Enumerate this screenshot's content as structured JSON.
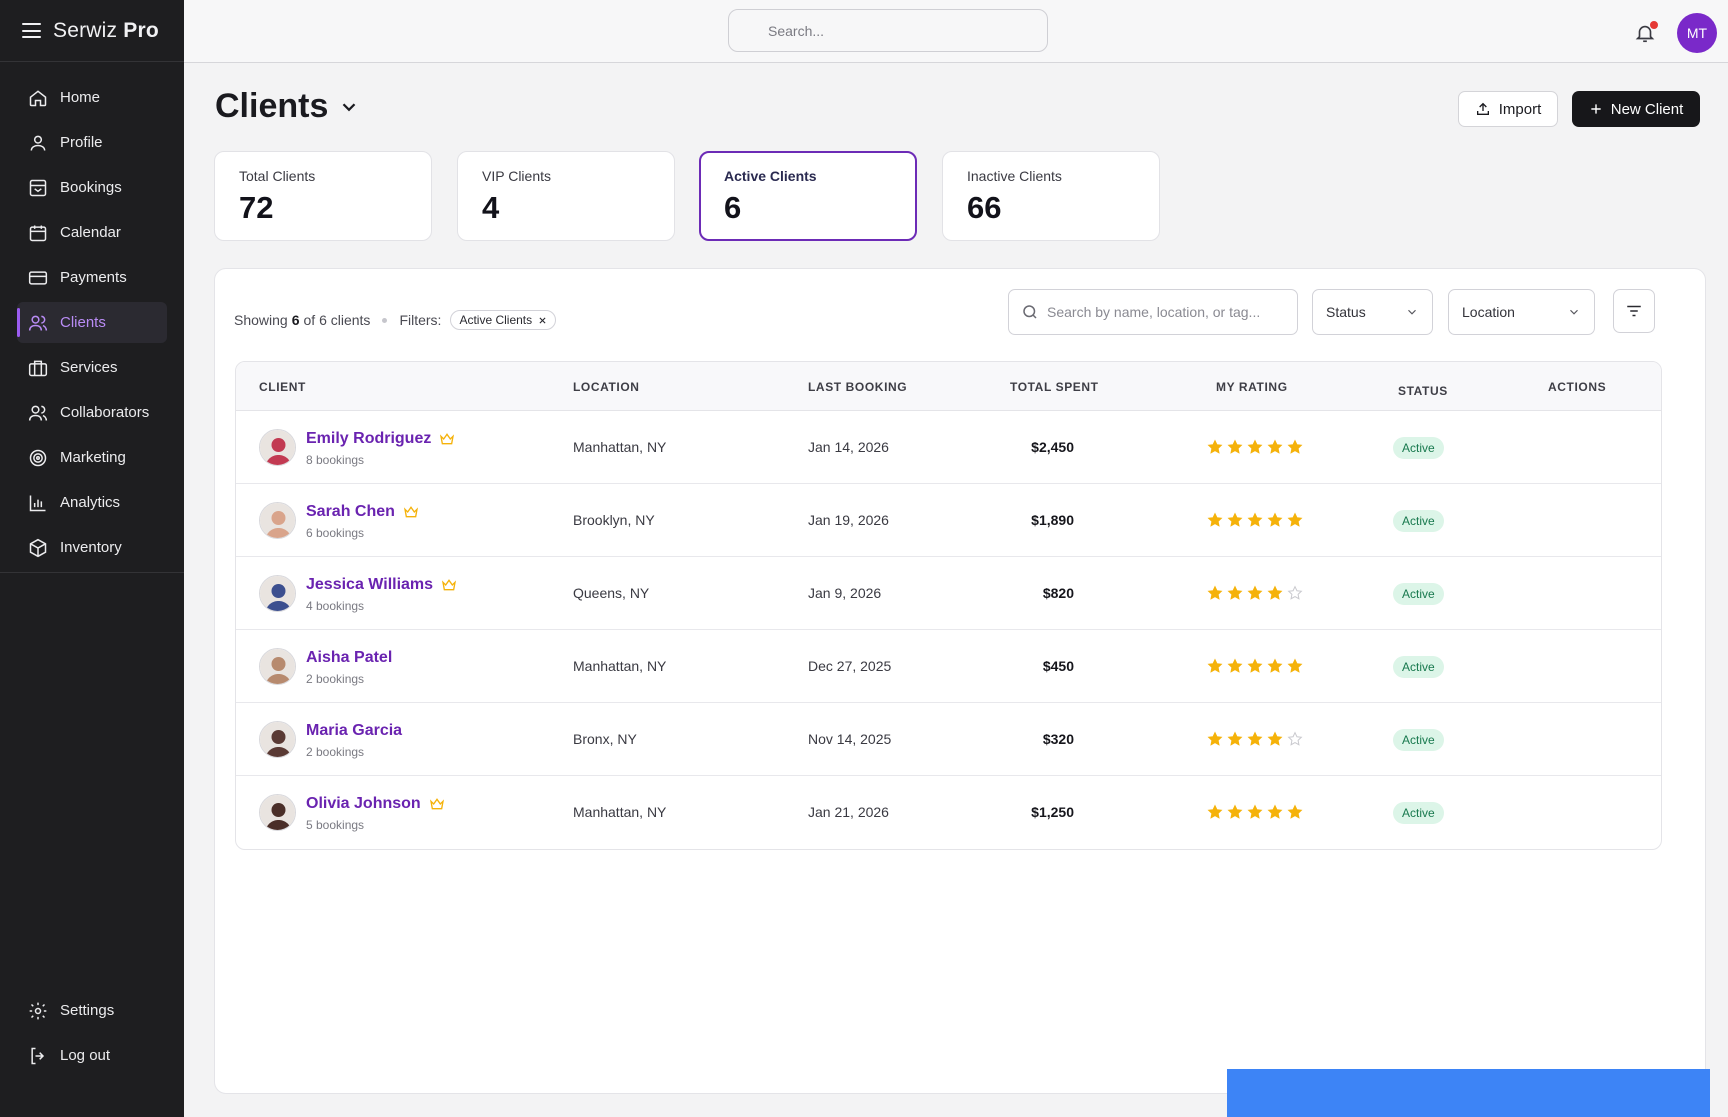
{
  "brand": {
    "name": "Serwiz",
    "suffix": "Pro"
  },
  "nav": {
    "items": [
      {
        "label": "Home",
        "icon": "home-icon"
      },
      {
        "label": "Profile",
        "icon": "user-icon"
      },
      {
        "label": "Bookings",
        "icon": "inbox-icon"
      },
      {
        "label": "Calendar",
        "icon": "calendar-icon"
      },
      {
        "label": "Payments",
        "icon": "card-icon"
      },
      {
        "label": "Clients",
        "icon": "users-icon",
        "active": true
      },
      {
        "label": "Services",
        "icon": "briefcase-icon"
      },
      {
        "label": "Collaborators",
        "icon": "users-icon"
      },
      {
        "label": "Marketing",
        "icon": "target-icon"
      },
      {
        "label": "Analytics",
        "icon": "bar-chart-icon"
      },
      {
        "label": "Inventory",
        "icon": "box-icon"
      }
    ],
    "bottom": [
      {
        "label": "Settings",
        "icon": "gear-icon"
      },
      {
        "label": "Log out",
        "icon": "logout-icon"
      }
    ]
  },
  "topbar": {
    "search_placeholder": "Search...",
    "avatar_initials": "MT",
    "has_notification": true
  },
  "header": {
    "title": "Clients",
    "import_label": "Import",
    "new_label": "New Client"
  },
  "stats": [
    {
      "label": "Total Clients",
      "value": "72"
    },
    {
      "label": "VIP Clients",
      "value": "4"
    },
    {
      "label": "Active Clients",
      "value": "6",
      "selected": true
    },
    {
      "label": "Inactive Clients",
      "value": "66"
    }
  ],
  "list": {
    "showing_prefix": "Showing",
    "showing_count": "6",
    "showing_suffix": "of 6 clients",
    "filters_label": "Filters:",
    "filter_chip": "Active Clients",
    "search_placeholder": "Search by name, location, or tag...",
    "status_select": "Status",
    "location_select": "Location"
  },
  "table": {
    "headers": {
      "client": "CLIENT",
      "location": "LOCATION",
      "last_booking": "LAST BOOKING",
      "total_spent": "TOTAL SPENT",
      "rating": "MY RATING",
      "status": "STATUS",
      "actions": "ACTIONS"
    },
    "rows": [
      {
        "name": "Emily Rodriguez",
        "bookings": "8 bookings",
        "vip": true,
        "location": "Manhattan, NY",
        "last_booking": "Jan 14, 2026",
        "total": "$2,450",
        "rating": 5,
        "status": "Active"
      },
      {
        "name": "Sarah Chen",
        "bookings": "6 bookings",
        "vip": true,
        "location": "Brooklyn, NY",
        "last_booking": "Jan 19, 2026",
        "total": "$1,890",
        "rating": 5,
        "status": "Active"
      },
      {
        "name": "Jessica Williams",
        "bookings": "4 bookings",
        "vip": true,
        "location": "Queens, NY",
        "last_booking": "Jan 9, 2026",
        "total": "$820",
        "rating": 4,
        "status": "Active"
      },
      {
        "name": "Aisha Patel",
        "bookings": "2 bookings",
        "vip": false,
        "location": "Manhattan, NY",
        "last_booking": "Dec 27, 2025",
        "total": "$450",
        "rating": 5,
        "status": "Active"
      },
      {
        "name": "Maria Garcia",
        "bookings": "2 bookings",
        "vip": false,
        "location": "Bronx, NY",
        "last_booking": "Nov 14, 2025",
        "total": "$320",
        "rating": 4,
        "status": "Active"
      },
      {
        "name": "Olivia Johnson",
        "bookings": "5 bookings",
        "vip": true,
        "location": "Manhattan, NY",
        "last_booking": "Jan 21, 2026",
        "total": "$1,250",
        "rating": 5,
        "status": "Active"
      }
    ]
  },
  "colors": {
    "accent": "#6c2bb6",
    "star": "#f5b20a",
    "badge_bg": "#dcf5e8",
    "badge_text": "#18794e"
  }
}
